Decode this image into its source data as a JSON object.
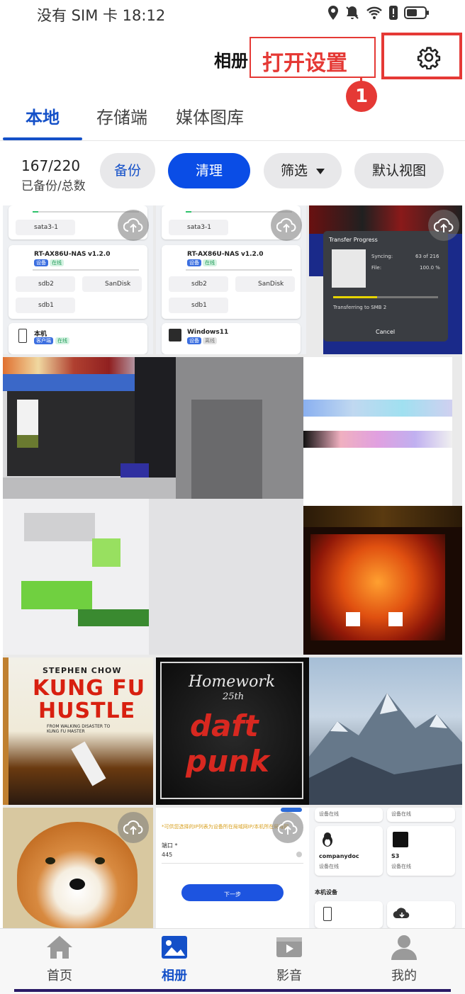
{
  "status": {
    "carrier_time": "没有 SIM 卡 18:12"
  },
  "header": {
    "title": "相册",
    "callout": "打开设置",
    "step_badge": "1"
  },
  "tabs": [
    {
      "label": "本地"
    },
    {
      "label": "存储端"
    },
    {
      "label": "媒体图库"
    }
  ],
  "actions": {
    "count": "167/220",
    "count_caption": "已备份/总数",
    "backup": "备份",
    "clean": "清理",
    "filter": "筛选",
    "view": "默认视图"
  },
  "thumbs": {
    "t1": {
      "sata": "sata3-1",
      "dev": "RT-AX86U-NAS",
      "ver": "v1.2.0",
      "tag1": "设备",
      "tag2": "在线",
      "sdb2": "sdb2",
      "sandisk": "SanDisk",
      "sdb1": "sdb1",
      "local": "本机",
      "local_tag": "客户端",
      "online": "在线"
    },
    "t2": {
      "sata": "sata3-1",
      "dev": "RT-AX86U-NAS",
      "ver": "v1.2.0",
      "tag1": "设备",
      "tag2": "在线",
      "sdb2": "sdb2",
      "sandisk": "SanDisk",
      "sdb1": "sdb1",
      "win": "Windows11",
      "win_tag": "设备",
      "offline": "离线"
    },
    "t3": {
      "dialog_title": "Transfer Progress",
      "syncing_label": "Syncing:",
      "syncing_value": "63 of 216",
      "file_label": "File:",
      "file_value": "100.0 %",
      "transferring": "Transferring to SMB 2",
      "cancel": "Cancel",
      "progress": 0.42
    },
    "poster1": {
      "top": "STEPHEN CHOW",
      "title1": "KUNG FU",
      "title2": "HUSTLE",
      "tagline": "FROM WALKING DISASTER TO KUNG FU MASTER"
    },
    "poster2": {
      "line1": "Homework",
      "line2": "25th",
      "band1": "daft",
      "band2": "punk"
    },
    "t10": {
      "warn": "*可供您选择的IP列表为设备所在局域网IP/本机所在局域网",
      "port_label": "端口 *",
      "port_value": "445",
      "next": "下一步"
    },
    "t11": {
      "status1": "设备在线",
      "status2": "设备在线",
      "dev1": "companydoc",
      "dev1_status": "设备在线",
      "dev2": "S3",
      "dev2_status": "设备在线",
      "section": "本机设备"
    }
  },
  "bottom_nav": [
    {
      "label": "首页"
    },
    {
      "label": "相册"
    },
    {
      "label": "影音"
    },
    {
      "label": "我的"
    }
  ],
  "colors": {
    "accent": "#1450c8",
    "annotation": "#e53935",
    "primary_button": "#0a4de6"
  }
}
